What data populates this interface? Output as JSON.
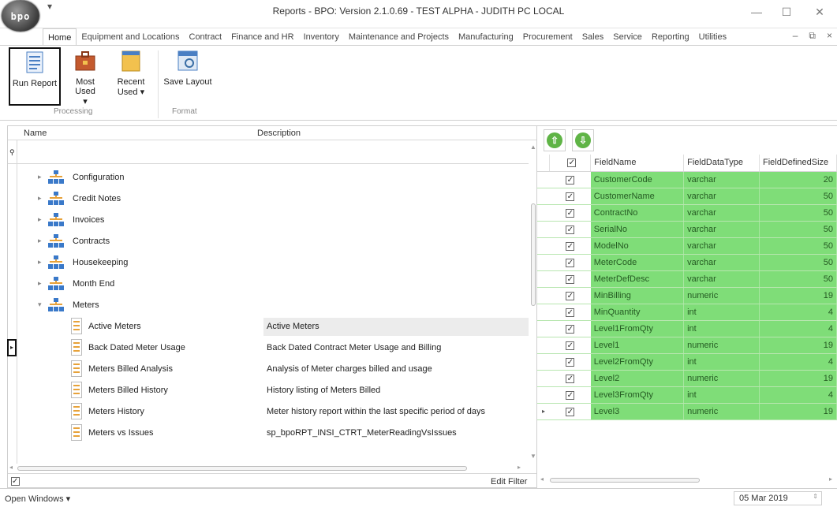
{
  "window": {
    "title": "Reports - BPO: Version 2.1.0.69 - TEST ALPHA - JUDITH PC LOCAL",
    "logo_text": "bpo",
    "minimize": "—",
    "restore": "☐",
    "close": "✕"
  },
  "ribbon": {
    "tabs": [
      "Home",
      "Equipment and Locations",
      "Contract",
      "Finance and HR",
      "Inventory",
      "Maintenance and Projects",
      "Manufacturing",
      "Procurement",
      "Sales",
      "Service",
      "Reporting",
      "Utilities"
    ],
    "active_tab": "Home",
    "buttons": {
      "run_report": "Run Report",
      "most_used": "Most Used",
      "recent_used_1": "Recent",
      "recent_used_2": "Used ▾",
      "save_layout": "Save Layout"
    },
    "groups": {
      "processing": "Processing",
      "format": "Format"
    }
  },
  "report_tree": {
    "columns": {
      "name": "Name",
      "description": "Description"
    },
    "folders": [
      "Configuration",
      "Credit Notes",
      "Invoices",
      "Contracts",
      "Housekeeping",
      "Month End",
      "Meters"
    ],
    "reports": [
      {
        "name": "Active Meters",
        "description": "Active Meters",
        "selected": true
      },
      {
        "name": "Back Dated Meter Usage",
        "description": "Back Dated Contract Meter Usage and Billing"
      },
      {
        "name": "Meters Billed Analysis",
        "description": "Analysis of Meter charges billed and usage"
      },
      {
        "name": "Meters Billed History",
        "description": "History listing of Meters Billed"
      },
      {
        "name": "Meters History",
        "description": "Meter history report within the last specific period of days"
      },
      {
        "name": "Meters vs Issues",
        "description": "sp_bpoRPT_INSI_CTRT_MeterReadingVsIssues"
      }
    ],
    "edit_filter": "Edit Filter"
  },
  "fields_grid": {
    "columns": [
      "FieldName",
      "FieldDataType",
      "FieldDefinedSize"
    ],
    "rows": [
      [
        "CustomerCode",
        "varchar",
        "20"
      ],
      [
        "CustomerName",
        "varchar",
        "50"
      ],
      [
        "ContractNo",
        "varchar",
        "50"
      ],
      [
        "SerialNo",
        "varchar",
        "50"
      ],
      [
        "ModelNo",
        "varchar",
        "50"
      ],
      [
        "MeterCode",
        "varchar",
        "50"
      ],
      [
        "MeterDefDesc",
        "varchar",
        "50"
      ],
      [
        "MinBilling",
        "numeric",
        "19"
      ],
      [
        "MinQuantity",
        "int",
        "4"
      ],
      [
        "Level1FromQty",
        "int",
        "4"
      ],
      [
        "Level1",
        "numeric",
        "19"
      ],
      [
        "Level2FromQty",
        "int",
        "4"
      ],
      [
        "Level2",
        "numeric",
        "19"
      ],
      [
        "Level3FromQty",
        "int",
        "4"
      ],
      [
        "Level3",
        "numeric",
        "19"
      ]
    ],
    "current_row": 14,
    "colors": {
      "row_fill": "#7fdd78",
      "row_text": "#245a22"
    }
  },
  "statusbar": {
    "open_windows": "Open Windows ▾",
    "date": "05 Mar 2019"
  }
}
